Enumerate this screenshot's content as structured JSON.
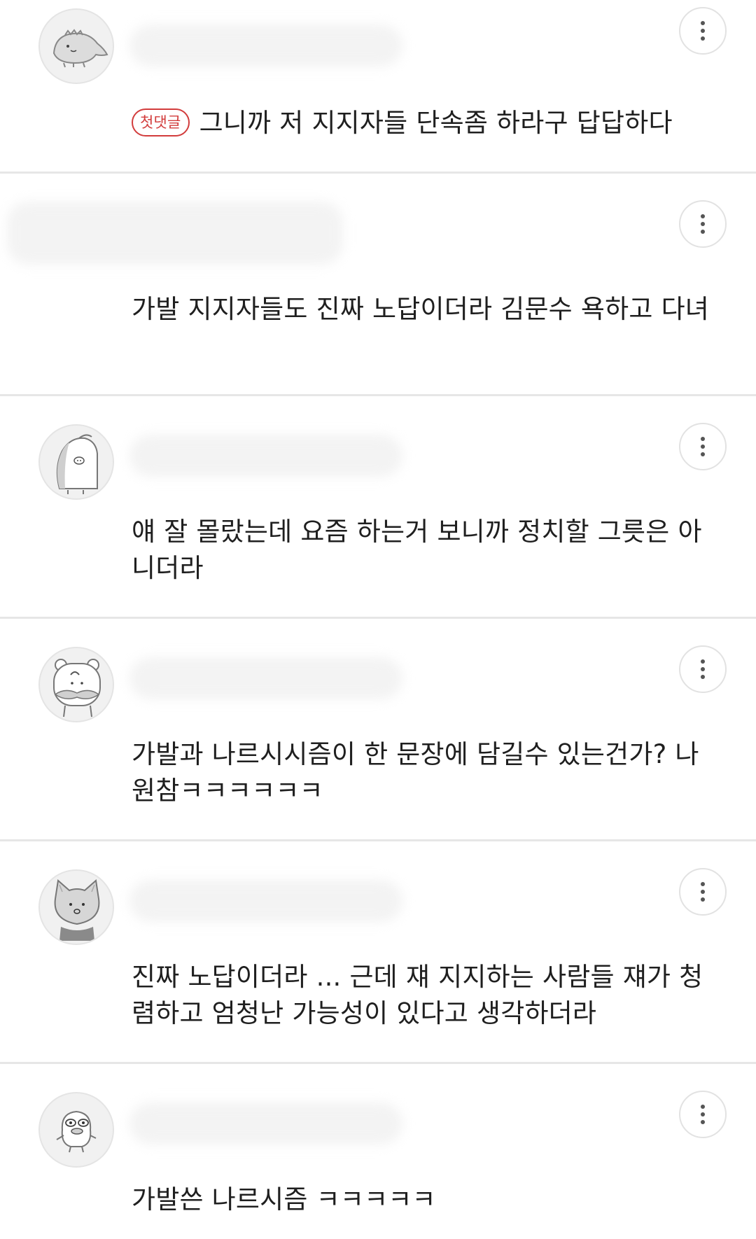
{
  "badge_label": "첫댓글",
  "comments": [
    {
      "text": "그니까 저 지지자들 단속좀 하라구 답답하다",
      "has_badge": true,
      "avatar_icon": "dinosaur-avatar-icon"
    },
    {
      "text": "가발 지지자들도 진짜 노답이더라 김문수 욕하고 다녀",
      "has_badge": false,
      "avatar_icon": "hidden-avatar"
    },
    {
      "text": "얘 잘 몰랐는데 요즘 하는거 보니까 정치할 그릇은 아니더라",
      "has_badge": false,
      "avatar_icon": "penguin-avatar-icon"
    },
    {
      "text": "가발과 나르시시즘이 한 문장에 담길수 있는건가? 나원참ㅋㅋㅋㅋㅋㅋ",
      "has_badge": false,
      "avatar_icon": "mustache-bear-avatar-icon"
    },
    {
      "text": "진짜 노답이더라 ... 근데 쟤 지지하는 사람들 쟤가 청렴하고 엄청난 가능성이 있다고 생각하더라",
      "has_badge": false,
      "avatar_icon": "cat-avatar-icon"
    },
    {
      "text": "가발쓴 나르시즘 ㅋㅋㅋㅋㅋ",
      "has_badge": false,
      "avatar_icon": "duck-avatar-icon"
    }
  ],
  "icons": {
    "more": "more-vertical-icon"
  },
  "colors": {
    "badge": "#d23c3c",
    "divider": "#e6e6e6",
    "text": "#1f1f1f"
  }
}
